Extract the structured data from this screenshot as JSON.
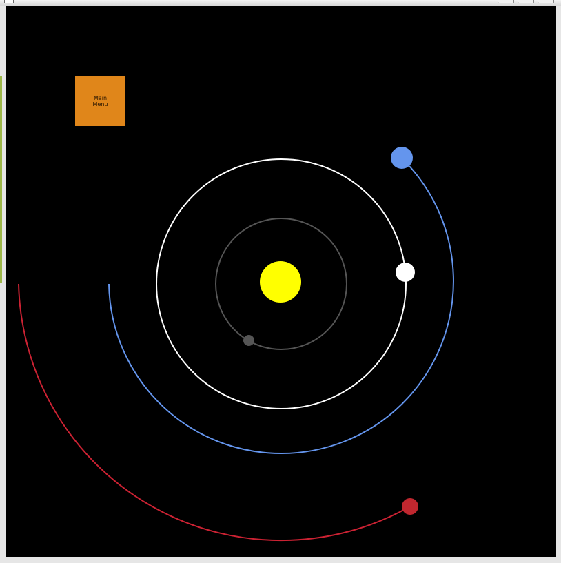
{
  "window": {
    "controls": [
      {
        "name": "minimize-button"
      },
      {
        "name": "maximize-button"
      },
      {
        "name": "close-button"
      }
    ]
  },
  "main_menu": {
    "label": "Main\nMenu",
    "color": "#e0861a"
  },
  "scene": {
    "background": "#000000",
    "sun": {
      "color": "#ffff00"
    },
    "orbits": [
      {
        "name": "gray-planet",
        "color": "#555555",
        "planet_color": "#555555",
        "trail": "full-ring",
        "planet_angle_deg": 208
      },
      {
        "name": "white-planet",
        "color": "#ffffff",
        "planet_color": "#ffffff",
        "trail": "full-ring",
        "planet_angle_deg": 3
      },
      {
        "name": "blue-planet",
        "color": "#6495ed",
        "planet_color": "#6495ed",
        "trail": "partial-arc",
        "planet_angle_deg": -59
      },
      {
        "name": "red-planet",
        "color": "#cc2233",
        "planet_color": "#c0272f",
        "trail": "partial-arc",
        "planet_angle_deg": 73
      }
    ]
  }
}
